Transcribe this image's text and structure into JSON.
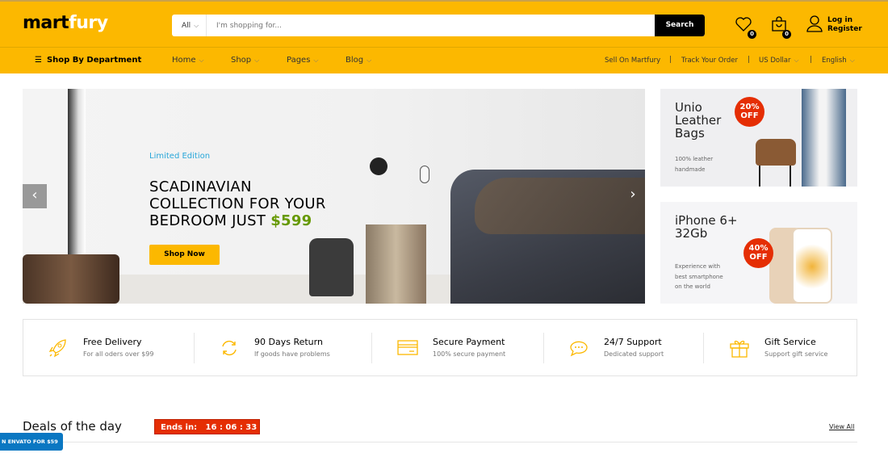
{
  "header": {
    "logo_dark": "mart",
    "logo_light": "fury",
    "search_category": "All",
    "search_placeholder": "I'm shopping for...",
    "search_button": "Search",
    "wishlist_count": "0",
    "cart_count": "0",
    "login": "Log in",
    "register": "Register"
  },
  "nav": {
    "department": "Shop By Department",
    "items": [
      "Home",
      "Shop",
      "Pages",
      "Blog"
    ],
    "right": {
      "sell": "Sell On Martfury",
      "track": "Track Your Order",
      "currency": "US Dollar",
      "language": "English",
      "divider": "|"
    }
  },
  "hero": {
    "eyebrow": "Limited Edition",
    "line1": "SCADINAVIAN",
    "line2": "COLLECTION FOR YOUR",
    "line3": "BEDROOM JUST ",
    "price": "$599",
    "button": "Shop Now",
    "prev": "‹",
    "next": "›"
  },
  "promos": [
    {
      "title1": "Unio",
      "title2": "Leather",
      "title3": "Bags",
      "sub1": "100% leather",
      "sub2": "handmade",
      "badge1": "20%",
      "badge2": "OFF"
    },
    {
      "title1": "iPhone 6+",
      "title2": "32Gb",
      "sub1": "Experience with",
      "sub2": "best smartphone",
      "sub3": "on the world",
      "badge1": "40%",
      "badge2": "OFF"
    }
  ],
  "features": [
    {
      "title": "Free Delivery",
      "sub": "For all oders over $99",
      "icon": "rocket-icon"
    },
    {
      "title": "90 Days Return",
      "sub": "If goods have problems",
      "icon": "refresh-icon"
    },
    {
      "title": "Secure Payment",
      "sub": "100% secure payment",
      "icon": "credit-card-icon"
    },
    {
      "title": "24/7 Support",
      "sub": "Dedicated support",
      "icon": "chat-icon"
    },
    {
      "title": "Gift Service",
      "sub": "Support gift service",
      "icon": "gift-icon"
    }
  ],
  "deals": {
    "title": "Deals of the day",
    "ends_label": "Ends in:",
    "countdown": "16 : 06 : 33",
    "view_all": "View All"
  },
  "envato": "N ENVATO FOR $59",
  "colors": {
    "accent": "#fcb800",
    "sale": "#e52e04",
    "price": "#669900",
    "link": "#27a6d9"
  }
}
